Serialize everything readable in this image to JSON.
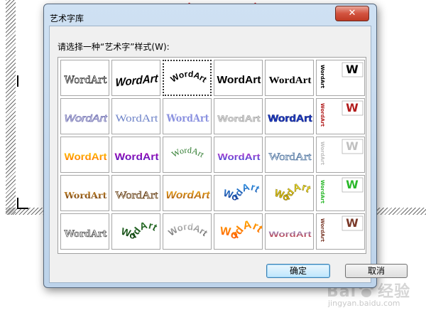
{
  "dialog": {
    "title": "艺术字库",
    "close_glyph": "✕",
    "prompt": "请选择一种“艺术字”样式(W):",
    "sample_text": "WordArt",
    "ok_label": "确定",
    "cancel_label": "取消"
  },
  "gallery": {
    "rows": 5,
    "columns": 6,
    "selected_index": 2
  },
  "watermark": {
    "logo_left": "Bai",
    "logo_right": "经验",
    "url": "jingyan.baidu.com"
  },
  "colors": {
    "title_bar": "#cfe1f3",
    "close_red": "#d35440",
    "accent_ring": "#d81e1e"
  }
}
